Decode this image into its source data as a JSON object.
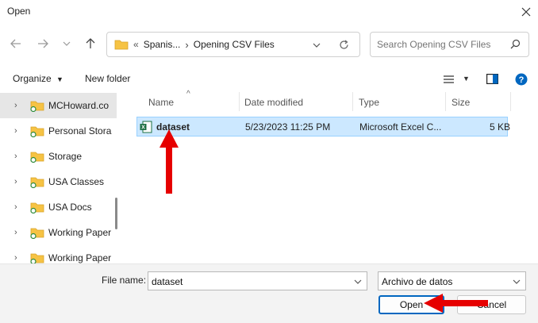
{
  "window": {
    "title": "Open"
  },
  "address": {
    "overflow": "«",
    "crumb1": "Spanis...",
    "crumb2": "Opening CSV Files"
  },
  "search": {
    "placeholder": "Search Opening CSV Files"
  },
  "toolbar": {
    "organize": "Organize",
    "new_folder": "New folder"
  },
  "sidebar": {
    "items": [
      {
        "label": "MCHoward.co"
      },
      {
        "label": "Personal Stora"
      },
      {
        "label": "Storage"
      },
      {
        "label": "USA Classes"
      },
      {
        "label": "USA Docs"
      },
      {
        "label": "Working Paper"
      },
      {
        "label": "Working Paper"
      }
    ]
  },
  "columns": {
    "name": "Name",
    "date": "Date modified",
    "type": "Type",
    "size": "Size"
  },
  "files": [
    {
      "name": "dataset",
      "date": "5/23/2023 11:25 PM",
      "type": "Microsoft Excel C...",
      "size": "5 KB"
    }
  ],
  "footer": {
    "file_name_label": "File name:",
    "file_name_value": "dataset",
    "file_type": "Archivo de datos",
    "open_label": "Open",
    "cancel_label": "Cancel"
  },
  "colors": {
    "folder": "#f6c344",
    "excel": "#1d6f42",
    "accent": "#0067c0",
    "annotation_arrow": "#e60000",
    "selection": "#cce8ff"
  }
}
